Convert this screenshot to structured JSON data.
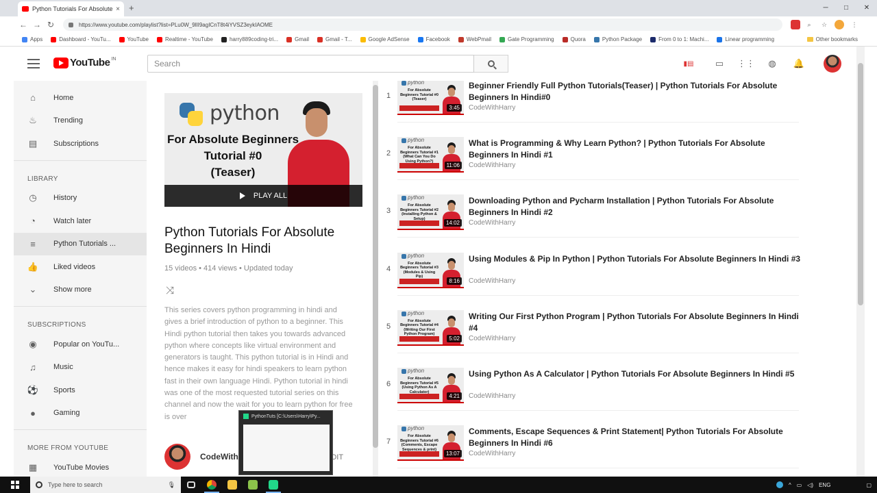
{
  "browser": {
    "tab_title": "Python Tutorials For Absolute Be...",
    "tab_close": "×",
    "new_tab": "+",
    "url": "https://www.youtube.com/playlist?list=PLu0W_9lII9agICnT8t4iYVSZ3eykIAOME",
    "window_min": "─",
    "window_max": "□",
    "window_close": "✕"
  },
  "bookmarks": {
    "items": [
      {
        "label": "Apps",
        "color": "#4285f4"
      },
      {
        "label": "Dashboard - YouTu...",
        "color": "#ff0000"
      },
      {
        "label": "YouTube",
        "color": "#ff0000"
      },
      {
        "label": "Realtime - YouTube",
        "color": "#ff0000"
      },
      {
        "label": "harry889coding-tri...",
        "color": "#222222"
      },
      {
        "label": "Gmail",
        "color": "#d93025"
      },
      {
        "label": "Gmail - T...",
        "color": "#d93025"
      },
      {
        "label": "Google AdSense",
        "color": "#fbbc04"
      },
      {
        "label": "Facebook",
        "color": "#1877f2"
      },
      {
        "label": "WebPmail",
        "color": "#c0392b"
      },
      {
        "label": "Gate Programming",
        "color": "#34a853"
      },
      {
        "label": "Quora",
        "color": "#b92b27"
      },
      {
        "label": "Python Package",
        "color": "#3776ab"
      },
      {
        "label": "From 0 to 1: Machi...",
        "color": "#1c2b6b"
      },
      {
        "label": "Linear programming",
        "color": "#1a73e8"
      }
    ],
    "other": "Other bookmarks"
  },
  "header": {
    "logo_word": "YouTube",
    "logo_region": "IN",
    "search_placeholder": "Search"
  },
  "sidebar": {
    "main": [
      {
        "label": "Home",
        "icon": "⌂"
      },
      {
        "label": "Trending",
        "icon": "♨"
      },
      {
        "label": "Subscriptions",
        "icon": "▤"
      }
    ],
    "library_heading": "LIBRARY",
    "library": [
      {
        "label": "History",
        "icon": "◷"
      },
      {
        "label": "Watch later",
        "icon": "◔"
      },
      {
        "label": "Python Tutorials ...",
        "icon": "≡"
      },
      {
        "label": "Liked videos",
        "icon": "👍"
      },
      {
        "label": "Show more",
        "icon": "⌄"
      }
    ],
    "subs_heading": "SUBSCRIPTIONS",
    "subs": [
      {
        "label": "Popular on YouTu...",
        "icon": "◉"
      },
      {
        "label": "Music",
        "icon": "♫"
      },
      {
        "label": "Sports",
        "icon": "⚽"
      },
      {
        "label": "Gaming",
        "icon": "●"
      }
    ],
    "more_heading": "MORE FROM YOUTUBE",
    "more": [
      {
        "label": "YouTube Movies",
        "icon": "▦"
      }
    ]
  },
  "playlist": {
    "thumb_brand": "python",
    "thumb_line1": "For Absolute Beginners",
    "thumb_line2": "Tutorial #0",
    "thumb_line3": "(Teaser)",
    "play_all": "PLAY ALL",
    "title": "Python Tutorials For Absolute Beginners In Hindi",
    "stats": "15 videos • 414 views • Updated today",
    "description": "This series covers python programming in hindi and gives a brief introduction of python to a beginner. This Hindi python tutorial then takes you towards advanced python where concepts like virtual environment and generators is taught. This python tutorial is in Hindi and hence makes it easy for hindi speakers to learn python fast in their own language Hindi. Python tutorial in hindi was one of the most requested tutorial series on this channel and now the wait for you to learn python for free is over",
    "channel": "CodeWithHarry",
    "edit": "EDIT"
  },
  "videos": [
    {
      "num": "1",
      "title": "Beginner Friendly Full Python Tutorials(Teaser) | Python Tutorials For Absolute Beginners In Hindi#0",
      "channel": "CodeWithHarry",
      "duration": "3:45",
      "thumb_text": "For Absolute Beginners Tutorial #0 (Teaser)"
    },
    {
      "num": "2",
      "title": "What is Programming & Why Learn Python? | Python Tutorials For Absolute Beginners In Hindi #1",
      "channel": "CodeWithHarry",
      "duration": "11:06",
      "thumb_text": "For Absolute Beginners Tutorial #1 (What Can You Do Using Python?)"
    },
    {
      "num": "3",
      "title": "Downloading Python and Pycharm Installation | Python Tutorials For Absolute Beginners In Hindi #2",
      "channel": "CodeWithHarry",
      "duration": "14:02",
      "thumb_text": "For Absolute Beginners Tutorial #2 (Installing Python & Setup)"
    },
    {
      "num": "4",
      "title": "Using Modules & Pip In Python | Python Tutorials For Absolute Beginners In Hindi #3",
      "channel": "CodeWithHarry",
      "duration": "8:16",
      "thumb_text": "For Absolute Beginners Tutorial #3 (Modules & Using Pip)"
    },
    {
      "num": "5",
      "title": "Writing Our First Python Program | Python Tutorials For Absolute Beginners In Hindi #4",
      "channel": "CodeWithHarry",
      "duration": "5:02",
      "thumb_text": "For Absolute Beginners Tutorial #4 (Writing Our First Python Program)"
    },
    {
      "num": "6",
      "title": "Using Python As A Calculator | Python Tutorials For Absolute Beginners In Hindi #5",
      "channel": "CodeWithHarry",
      "duration": "4:21",
      "thumb_text": "For Absolute Beginners Tutorial #5 (Using Python As A Calculator)"
    },
    {
      "num": "7",
      "title": "Comments, Escape Sequences & Print Statement| Python Tutorials For Absolute Beginners In Hindi #6",
      "channel": "CodeWithHarry",
      "duration": "13:07",
      "thumb_text": "For Absolute Beginners Tutorial #6 (Comments, Escape Sequences & print)"
    }
  ],
  "taskbar": {
    "search_placeholder": "Type here to search",
    "preview_title": "PythonTuts [C:\\Users\\Harry\\Py...",
    "tray_lang": "ENG",
    "tray_up": "^"
  }
}
